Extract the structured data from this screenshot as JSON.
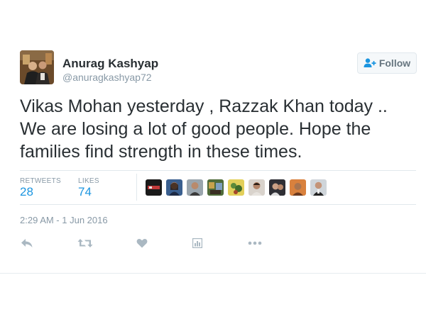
{
  "author": {
    "name": "Anurag Kashyap",
    "handle": "@anuragkashyap72",
    "avatar_icon": "profile-photo"
  },
  "follow_button": {
    "label": "Follow",
    "icon": "add-user-icon"
  },
  "tweet": {
    "lines": [
      "Vikas Mohan yesterday , Razzak Khan today ..",
      "We are losing a lot of good people. Hope the",
      "families find strength in these times."
    ]
  },
  "stats": {
    "retweets_label": "RETWEETS",
    "retweets": "28",
    "likes_label": "LIKES",
    "likes": "74"
  },
  "timestamp": "2:29 AM - 1 Jun 2016",
  "actions": [
    "reply-icon",
    "retweet-icon",
    "like-icon",
    "analytics-icon",
    "more-icon"
  ],
  "colors": {
    "accent": "#1b95e0",
    "text": "#292f33",
    "muted": "#8899a6",
    "action_icon": "#aab8c2",
    "border": "#e1e8ed"
  }
}
